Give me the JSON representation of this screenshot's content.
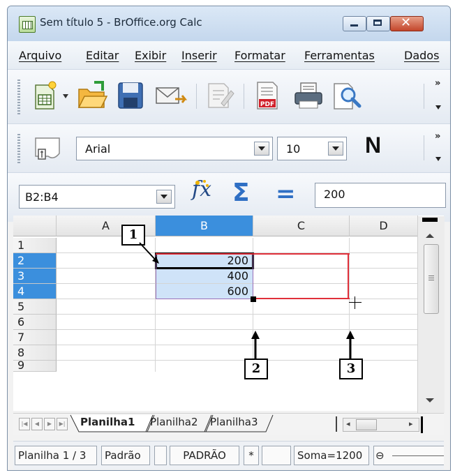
{
  "window": {
    "title": "Sem título 5 - BrOffice.org Calc"
  },
  "menu": [
    "Arquivo",
    "Editar",
    "Exibir",
    "Inserir",
    "Formatar",
    "Ferramentas",
    "Dados"
  ],
  "toolbar2": {
    "font_name": "Arial",
    "font_size": "10",
    "bold_label": "N"
  },
  "formula_bar": {
    "name_box": "B2:B4",
    "input": "200",
    "sum_symbol": "Σ",
    "equals_symbol": "="
  },
  "grid": {
    "columns": [
      "A",
      "B",
      "C",
      "D"
    ],
    "rows": [
      "1",
      "2",
      "3",
      "4",
      "5",
      "6",
      "7",
      "8",
      "9"
    ],
    "cells": {
      "B2": "200",
      "B3": "400",
      "B4": "600"
    }
  },
  "sheet_tabs": [
    "Planilha1",
    "Planilha2",
    "Planilha3"
  ],
  "statusbar": {
    "sheet": "Planilha 1 / 3",
    "style": "Padrão",
    "mode": "PADRÃO",
    "modified": "*",
    "sum": "Soma=1200",
    "zoom_out": "⊖"
  },
  "callouts": [
    "1",
    "2",
    "3"
  ],
  "colors": {
    "selection_header": "#3b8fdd",
    "selection_fill": "#cfe3f8",
    "target_range_border": "#e0303a"
  }
}
